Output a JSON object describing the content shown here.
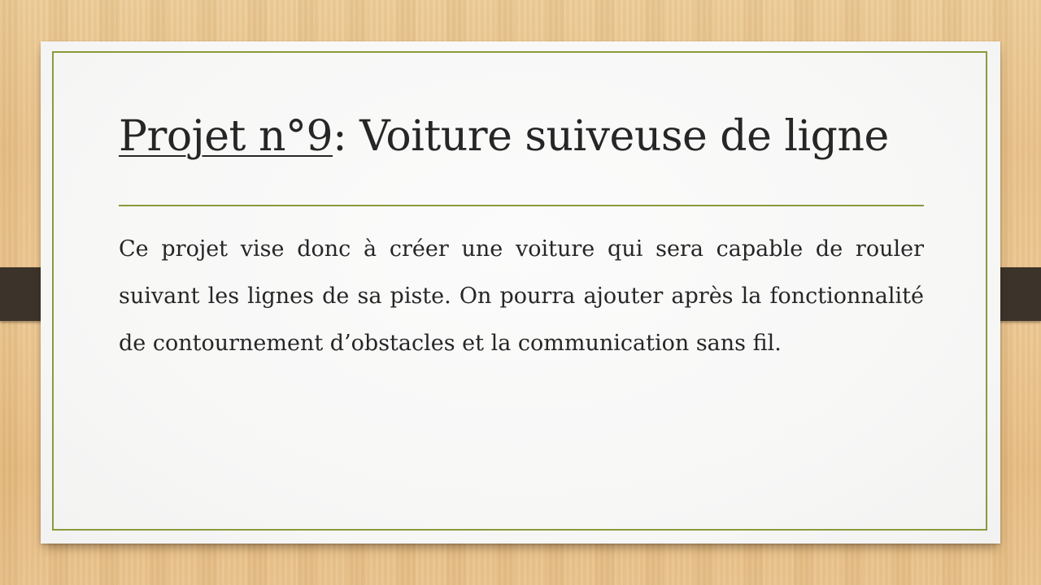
{
  "slide": {
    "title_underlined": "Projet n°9",
    "title_rest": ": Voiture suiveuse de ligne",
    "body": "Ce projet vise donc à créer une voiture qui sera capable de rouler suivant les lignes de sa piste. On pourra ajouter après la fonctionnalité de contournement d’obstacles et la communication sans fil."
  },
  "colors": {
    "accent": "#8a9a3c",
    "text": "#262626",
    "tab": "#3c332a",
    "card": "#f7f7f6",
    "background": "#e8c088"
  }
}
